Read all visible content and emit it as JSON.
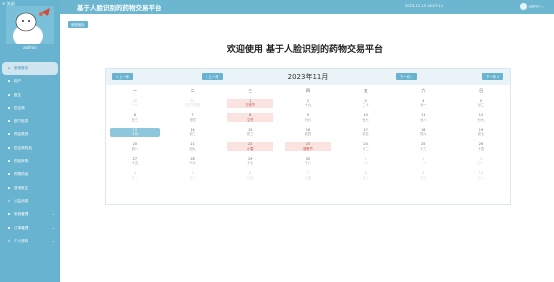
{
  "sidebar": {
    "close_label": "✕ 关闭",
    "username": "admin",
    "items": [
      {
        "label": "系统首页",
        "icon": "home-icon",
        "glyph": "⌂"
      },
      {
        "label": "用户",
        "icon": "user-icon",
        "glyph": "▪"
      },
      {
        "label": "医生",
        "icon": "grid-icon",
        "glyph": "▪"
      },
      {
        "label": "供应商",
        "icon": "person-icon",
        "glyph": "▪"
      },
      {
        "label": "部门信息",
        "icon": "grid-icon",
        "glyph": "▪"
      },
      {
        "label": "药品类别",
        "icon": "grid-icon",
        "glyph": "▪"
      },
      {
        "label": "供应商药品",
        "icon": "grid-icon",
        "glyph": "▪"
      },
      {
        "label": "药品采购",
        "icon": "grid-icon",
        "glyph": "▪"
      },
      {
        "label": "药物药品",
        "icon": "person-icon",
        "glyph": "▪"
      },
      {
        "label": "咨询医生",
        "icon": "grid-icon",
        "glyph": "▪"
      },
      {
        "label": "公益消息",
        "icon": "doc-icon",
        "glyph": "▫"
      },
      {
        "label": "系统管理",
        "icon": "grid-icon",
        "glyph": "▪",
        "chev": "⌄"
      },
      {
        "label": "订单管理",
        "icon": "grid-icon",
        "glyph": "▪",
        "chev": "⌄"
      },
      {
        "label": "个人资料",
        "icon": "doc-icon",
        "glyph": "▫",
        "chev": "⌄"
      }
    ]
  },
  "header": {
    "title": "基于人脸识别的药物交易平台",
    "datetime": "2023-11-15 16:27:11",
    "user": "admin ⌄"
  },
  "breadcrumb": "系统首页",
  "welcome": "欢迎使用 基于人脸识别的药物交易平台",
  "calendar": {
    "prev_year": "« 上一年",
    "prev_month": "‹ 上一月",
    "month_title": "2023年11月",
    "next_month": "下一月 ›",
    "next_year": "下一年 »",
    "weekdays": [
      "一",
      "二",
      "三",
      "四",
      "五",
      "六",
      "日"
    ],
    "days": [
      {
        "d": "30",
        "l": "十七",
        "o": true
      },
      {
        "d": "31",
        "l": "万圣节前夜",
        "o": true
      },
      {
        "d": "1",
        "l": "万圣节",
        "f": true
      },
      {
        "d": "2",
        "l": "十九"
      },
      {
        "d": "3",
        "l": "二十"
      },
      {
        "d": "4",
        "l": "廿一"
      },
      {
        "d": "5",
        "l": "廿二"
      },
      {
        "d": "6",
        "l": "廿三"
      },
      {
        "d": "7",
        "l": "廿四"
      },
      {
        "d": "8",
        "l": "立冬",
        "f": true
      },
      {
        "d": "9",
        "l": "廿六"
      },
      {
        "d": "10",
        "l": "廿七"
      },
      {
        "d": "11",
        "l": "廿八"
      },
      {
        "d": "12",
        "l": "廿九"
      },
      {
        "d": "13",
        "l": "十月"
      },
      {
        "d": "14",
        "l": "初二"
      },
      {
        "d": "15",
        "l": "初三"
      },
      {
        "d": "16",
        "l": "初四"
      },
      {
        "d": "17",
        "l": "初五"
      },
      {
        "d": "18",
        "l": "初六"
      },
      {
        "d": "19",
        "l": "初七"
      },
      {
        "d": "20",
        "l": "初八"
      },
      {
        "d": "21",
        "l": "初九"
      },
      {
        "d": "22",
        "l": "小雪",
        "f": true
      },
      {
        "d": "23",
        "l": "感恩节",
        "f": true
      },
      {
        "d": "24",
        "l": "十二"
      },
      {
        "d": "25",
        "l": "十三"
      },
      {
        "d": "26",
        "l": "十四"
      },
      {
        "d": "27",
        "l": "十五"
      },
      {
        "d": "28",
        "l": "十六"
      },
      {
        "d": "29",
        "l": "十七"
      },
      {
        "d": "30",
        "l": "十八"
      },
      {
        "d": "1",
        "l": "十九",
        "o": true
      },
      {
        "d": "2",
        "l": "二十",
        "o": true
      },
      {
        "d": "3",
        "l": "廿一",
        "o": true
      },
      {
        "d": "4",
        "l": "廿二",
        "o": true
      },
      {
        "d": "5",
        "l": "廿三",
        "o": true
      },
      {
        "d": "6",
        "l": "廿四",
        "o": true
      },
      {
        "d": "7",
        "l": "大雪",
        "o": true
      },
      {
        "d": "8",
        "l": "廿六",
        "o": true
      },
      {
        "d": "9",
        "l": "廿七",
        "o": true
      },
      {
        "d": "10",
        "l": "廿八",
        "o": true
      }
    ],
    "today_index": 14
  }
}
